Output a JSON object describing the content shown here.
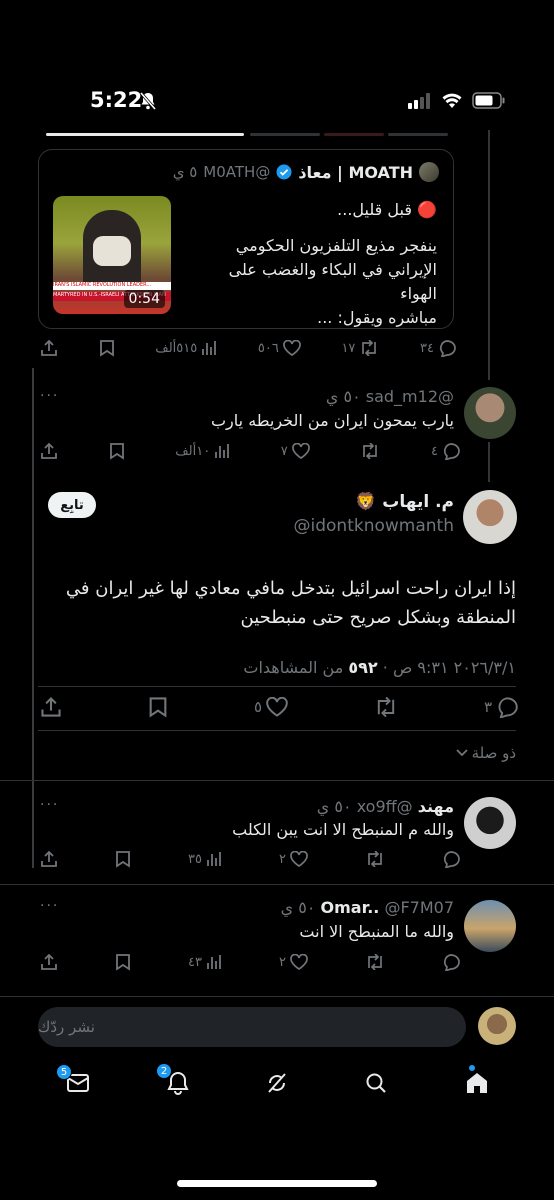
{
  "status_bar": {
    "time": "5:22"
  },
  "quoted_tweet": {
    "name": "MOATH | معاذ",
    "handle": "@M0ATH",
    "time": "٥ ي",
    "text_line1": "🔴 قبل قليل...",
    "text_line2": "ينفجر مذيع التلفزيون الحكومي",
    "text_line3": "الإيراني في البكاء والغضب على الهواء",
    "text_line4": "مباشره ويقول: ...",
    "video_duration": "0:54",
    "video_caption_1": "IRAN'S ISLAMIC REVOLUTION LEADER...",
    "video_caption_2": "MARTYRED IN U.S.-ISRAELI ATTACKS ON IRAN"
  },
  "quoted_actions": {
    "replies": "٣٤",
    "reposts": "١٧",
    "likes": "٥٠٦",
    "views": "٥١٥ألف"
  },
  "reply_1": {
    "handle": "@sad_m12",
    "time": "٥٠ ي",
    "text": "يارب يمحون ايران من الخريطه يارب",
    "replies": "٤",
    "likes": "٧",
    "views": "١٠ألف"
  },
  "main_tweet": {
    "name": "م. ايهاب",
    "emoji": "🦁",
    "handle": "@idontknowmanth",
    "follow_label": "تابِع",
    "text_line1": "إذا ايران راحت اسرائيل بتدخل مافي معادي لها غير ايران في",
    "text_line2": "المنطقة وبشكل صريح حتى منبطحين",
    "date": "٢٠٢٦/٣/١ ٩:٣١ ص",
    "views_count": "٥٩٢",
    "views_label": "من المشاهدات",
    "replies": "٣",
    "likes": "٥"
  },
  "relevance_label": "ذو صلة",
  "reply_2": {
    "name": "مهند",
    "handle": "@xo9ff",
    "time": "٥٠ ي",
    "text": "والله م المنبطح الا انت يبن الكلب",
    "likes": "٢",
    "views": "٣٥"
  },
  "reply_3": {
    "name": "Omar..",
    "handle": "@F7M07",
    "time": "٥٠ ي",
    "text": "والله ما المنبطح الا انت",
    "likes": "٢",
    "views": "٤٣"
  },
  "reply_input": {
    "placeholder": "نشر ردّك"
  },
  "bottom_nav": {
    "messages_badge": "5",
    "notifications_badge": "2"
  },
  "colors": {
    "accent": "#1d9bf0",
    "background": "#000000",
    "secondary_text": "#71767b"
  }
}
